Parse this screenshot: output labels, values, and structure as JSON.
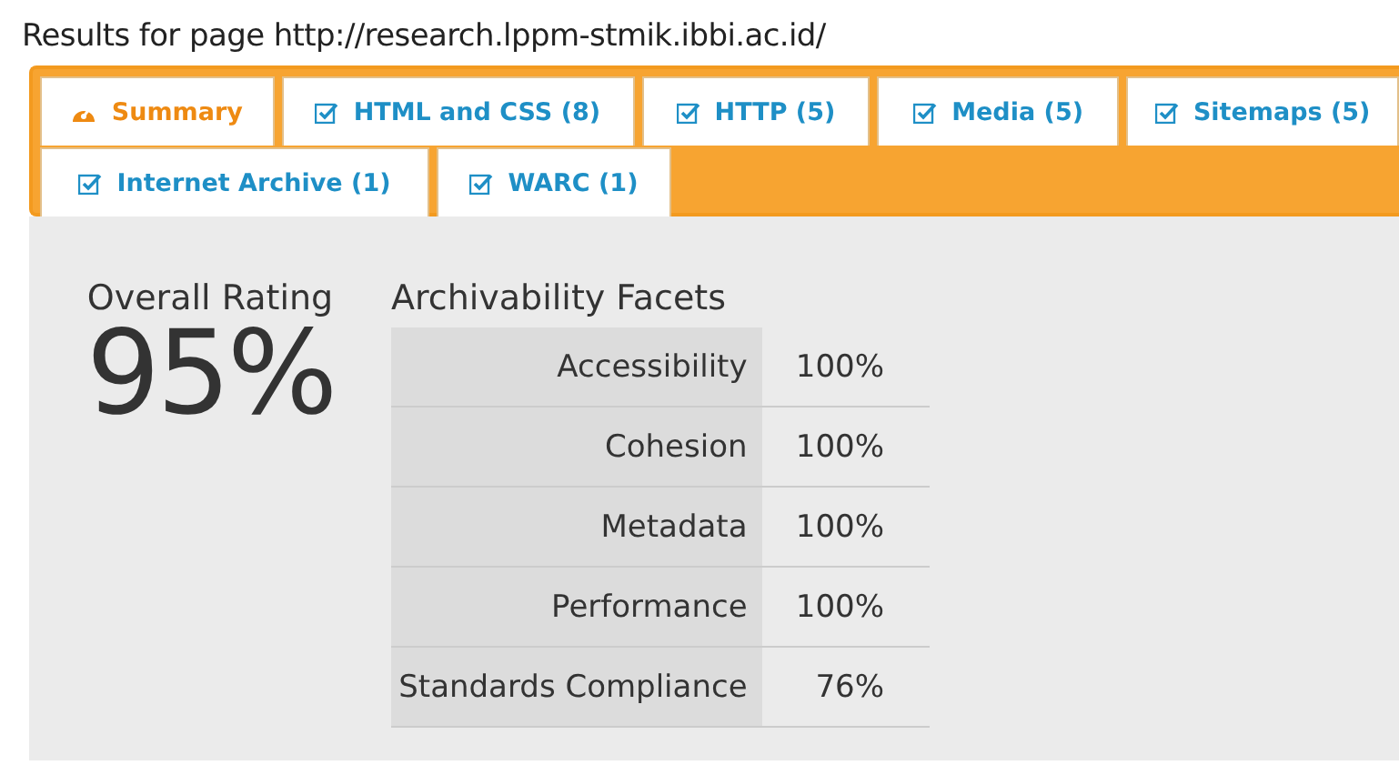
{
  "heading": "Results for page http://research.lppm-stmik.ibbi.ac.id/",
  "tabs": [
    {
      "label": "Summary",
      "kind": "gauge",
      "selected": true
    },
    {
      "label": "HTML and CSS (8)",
      "kind": "check",
      "selected": false
    },
    {
      "label": "HTTP (5)",
      "kind": "check",
      "selected": false
    },
    {
      "label": "Media (5)",
      "kind": "check",
      "selected": false
    },
    {
      "label": "Sitemaps (5)",
      "kind": "check",
      "selected": false
    },
    {
      "label": "Internet Archive (1)",
      "kind": "check",
      "selected": false
    },
    {
      "label": "WARC (1)",
      "kind": "check",
      "selected": false
    }
  ],
  "overall": {
    "label": "Overall Rating",
    "value": "95%"
  },
  "facets": {
    "title": "Archivability Facets",
    "rows": [
      {
        "name": "Accessibility",
        "value": "100%"
      },
      {
        "name": "Cohesion",
        "value": "100%"
      },
      {
        "name": "Metadata",
        "value": "100%"
      },
      {
        "name": "Performance",
        "value": "100%"
      },
      {
        "name": "Standards Compliance",
        "value": "76%"
      }
    ]
  }
}
